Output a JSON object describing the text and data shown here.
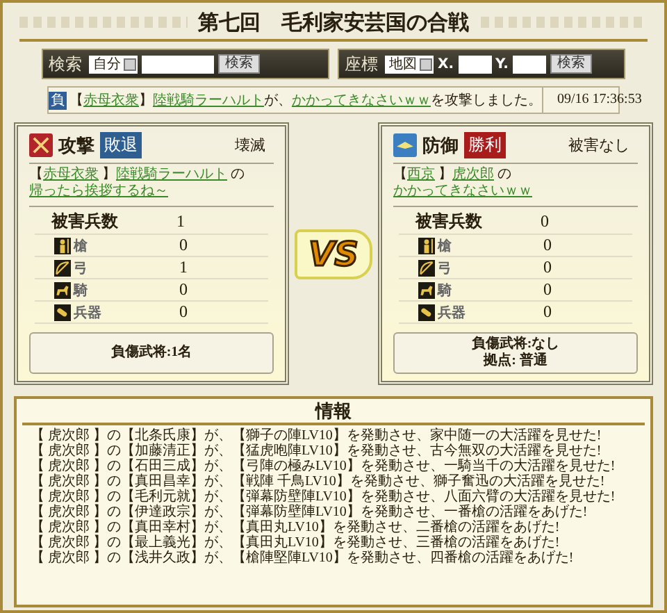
{
  "title": "第七回　毛利家安芸国の合戦",
  "search": {
    "label": "検索",
    "select": "自分",
    "button": "検索"
  },
  "coords": {
    "label": "座標",
    "select": "地図",
    "x_label": "X.",
    "y_label": "Y.",
    "button": "検索"
  },
  "notice": {
    "badge": "負",
    "parts": [
      {
        "kind": "text",
        "text": "【"
      },
      {
        "kind": "link",
        "text": "赤母衣衆"
      },
      {
        "kind": "text",
        "text": " 】"
      },
      {
        "kind": "link",
        "text": "陸戦騎ラーハルト"
      },
      {
        "kind": "text",
        "text": " が、 "
      },
      {
        "kind": "link",
        "text": "かかってきなさいｗｗ"
      },
      {
        "kind": "text",
        "text": " を攻撃しました。"
      }
    ],
    "time": "09/16 17:36:53"
  },
  "sides": [
    {
      "kind": "attack",
      "role": "攻撃",
      "result": {
        "kind": "defeat",
        "text": "敗退"
      },
      "damage": "壊滅",
      "parts": [
        {
          "kind": "text",
          "text": "【"
        },
        {
          "kind": "link",
          "text": "赤母衣衆"
        },
        {
          "kind": "text",
          "text": " 】"
        },
        {
          "kind": "link",
          "text": "陸戦騎ラーハルト"
        },
        {
          "kind": "text",
          "text": " の "
        },
        {
          "kind": "link",
          "text": "帰ったら挨拶するね～"
        }
      ],
      "total_label": "被害兵数",
      "total": "1",
      "rows": [
        {
          "kind": "spear",
          "label": "槍",
          "value": "0"
        },
        {
          "kind": "bow",
          "label": "弓",
          "value": "1"
        },
        {
          "kind": "horse",
          "label": "騎",
          "value": "0"
        },
        {
          "kind": "siege",
          "label": "兵器",
          "value": "0"
        }
      ],
      "footer": [
        "負傷武将:1名"
      ]
    },
    {
      "kind": "defense",
      "role": "防御",
      "result": {
        "kind": "victory",
        "text": "勝利"
      },
      "damage": "被害なし",
      "parts": [
        {
          "kind": "text",
          "text": "【"
        },
        {
          "kind": "link",
          "text": "西京"
        },
        {
          "kind": "text",
          "text": " 】"
        },
        {
          "kind": "link",
          "text": "虎次郎"
        },
        {
          "kind": "text",
          "text": " の "
        },
        {
          "kind": "link",
          "text": "かかってきなさいｗｗ"
        }
      ],
      "total_label": "被害兵数",
      "total": "0",
      "rows": [
        {
          "kind": "spear",
          "label": "槍",
          "value": "0"
        },
        {
          "kind": "bow",
          "label": "弓",
          "value": "0"
        },
        {
          "kind": "horse",
          "label": "騎",
          "value": "0"
        },
        {
          "kind": "siege",
          "label": "兵器",
          "value": "0"
        }
      ],
      "footer": [
        "負傷武将:なし",
        "拠点: 普通"
      ]
    }
  ],
  "vs": "VS",
  "info": {
    "title": "情報",
    "lines": [
      "【 虎次郎 】の【北条氏康】が、【獅子の陣LV10】を発動させ、家中随一の大活躍を見せた!",
      "【 虎次郎 】の【加藤清正】が、【猛虎咆陣LV10】を発動させ、古今無双の大活躍を見せた!",
      "【 虎次郎 】の【石田三成】が、【弓陣の極みLV10】を発動させ、一騎当千の大活躍を見せた!",
      "【 虎次郎 】の【真田昌幸】が、【戦陣 千鳥LV10】を発動させ、獅子奮迅の大活躍を見せた!",
      "【 虎次郎 】の【毛利元就】が、【弾幕防壁陣LV10】を発動させ、八面六臂の大活躍を見せた!",
      "【 虎次郎 】の【伊達政宗】が、【弾幕防壁陣LV10】を発動させ、一番槍の活躍をあげた!",
      "【 虎次郎 】の【真田幸村】が、【真田丸LV10】を発動させ、二番槍の活躍をあげた!",
      "【 虎次郎 】の【最上義光】が、【真田丸LV10】を発動させ、三番槍の活躍をあげた!",
      "【 虎次郎 】の【浅井久政】が、【槍陣堅陣LV10】を発動させ、四番槍の活躍をあげた!"
    ]
  }
}
